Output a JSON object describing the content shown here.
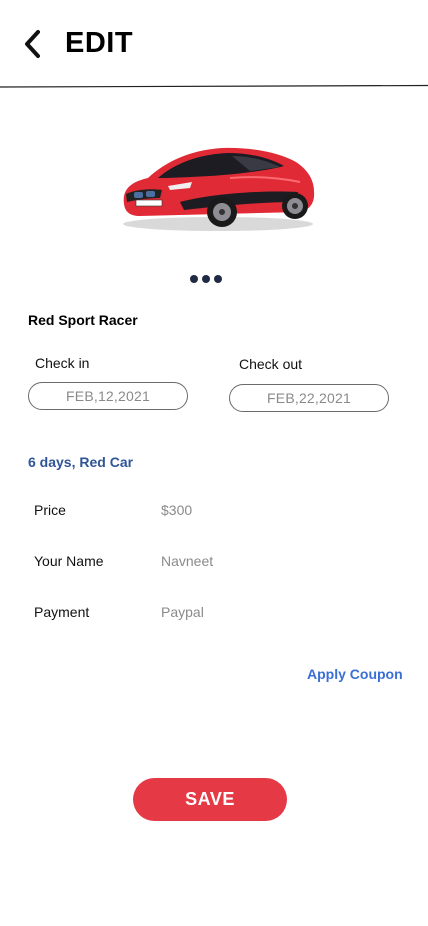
{
  "header": {
    "title": "EDIT",
    "back_icon": "chevron-left-icon"
  },
  "car": {
    "name": "Red Sport Racer",
    "image": "red-sports-car",
    "body_color": "#e02a35"
  },
  "carousel": {
    "pages": 3,
    "dot_color": "#1f2a44"
  },
  "booking": {
    "check_in_label": "Check in",
    "check_in_date": "FEB,12,2021",
    "check_out_label": "Check out",
    "check_out_date": "FEB,22,2021",
    "summary": "6 days, Red Car"
  },
  "details": [
    {
      "label": "Price",
      "value": "$300"
    },
    {
      "label": "Your Name",
      "value": "Navneet"
    },
    {
      "label": "Payment",
      "value": "Paypal"
    }
  ],
  "coupon_label": "Apply Coupon",
  "save_label": "SAVE",
  "colors": {
    "accent": "#e63946",
    "summary_text": "#2f5597",
    "link": "#3a6fd6"
  }
}
